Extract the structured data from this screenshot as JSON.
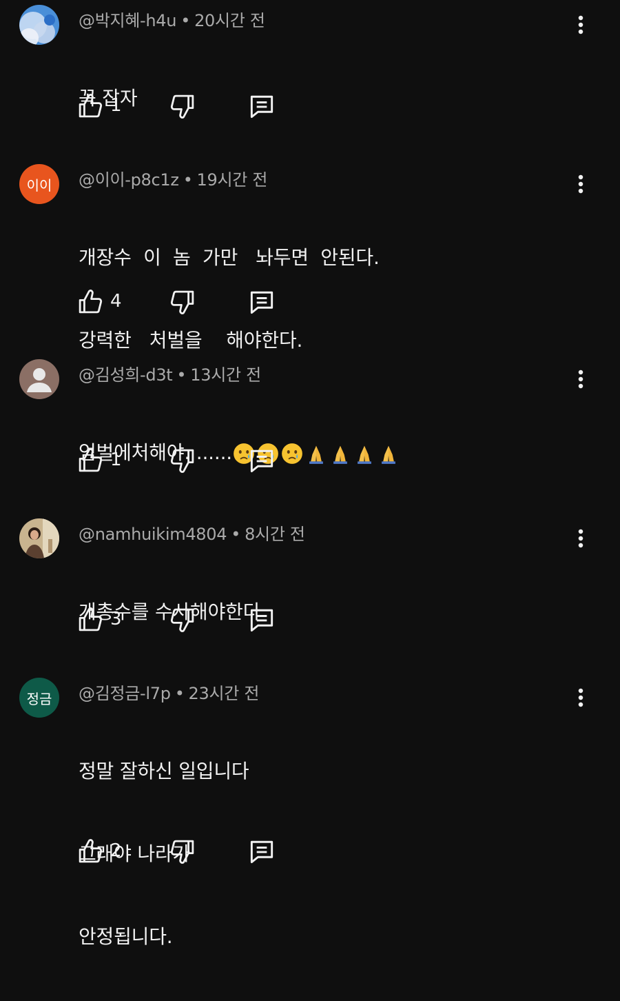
{
  "colors": {
    "background": "#0f0f0f",
    "meta_text": "#aaaaaa",
    "body_text": "#f1f1f1",
    "avatar_ii": "#e8551e",
    "avatar_jeonggeum": "#0e5a48",
    "avatar_default": "#8b6f65"
  },
  "comments": [
    {
      "author": "@박지혜-h4u",
      "time": "20시간 전",
      "lines": [
        "꼭 잡자"
      ],
      "likes": "1",
      "avatar_type": "photo-sky"
    },
    {
      "author": "@이이-p8c1z",
      "time": "19시간 전",
      "lines": [
        "개장수  이  놈  가만   놔두면  안된다.",
        "강력한   처벌을    해야한다."
      ],
      "likes": "4",
      "avatar_text": "이이"
    },
    {
      "author": "@김성희-d3t",
      "time": "13시간 전",
      "lines": [
        "엄벌에처해야. ......"
      ],
      "emojis": [
        "crying-face-emoji",
        "crying-face-emoji",
        "crying-face-emoji",
        "folded-hands-emoji",
        "folded-hands-emoji",
        "folded-hands-emoji",
        "folded-hands-emoji"
      ],
      "likes": "1",
      "avatar_type": "default-person"
    },
    {
      "author": "@namhuikim4804",
      "time": "8시간 전",
      "lines": [
        "개총수를 수사해야한다"
      ],
      "likes": "3",
      "avatar_type": "photo-person"
    },
    {
      "author": "@김정금-l7p",
      "time": "23시간 전",
      "lines": [
        "정말 잘하신 일입니다",
        "그래야 나라가",
        "안정됩니다."
      ],
      "likes": "2",
      "avatar_text": "정금"
    }
  ],
  "icons": {
    "like": "thumbs-up-icon",
    "dislike": "thumbs-down-icon",
    "reply": "reply-comment-icon",
    "more": "more-vert-icon"
  }
}
